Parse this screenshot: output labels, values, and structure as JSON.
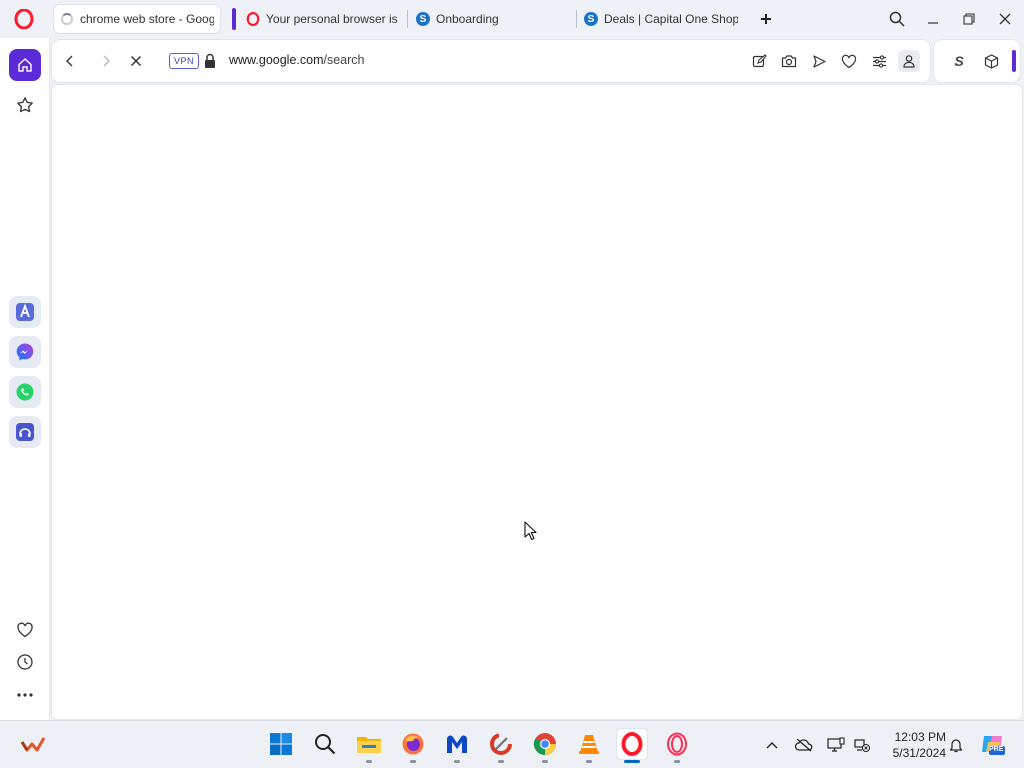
{
  "browser": {
    "tabs": [
      {
        "title": "chrome web store - Google Search",
        "icon": "loading-spinner",
        "active": true
      },
      {
        "title": "Your personal browser is awesome",
        "icon": "opera-icon",
        "active": false
      },
      {
        "title": "Onboarding",
        "icon": "capital-one-shopping-icon",
        "active": false
      },
      {
        "title": "Deals | Capital One Shopping",
        "icon": "capital-one-shopping-icon",
        "active": false
      }
    ],
    "address_bar": {
      "vpn_label": "VPN",
      "url_host": "www.google.com",
      "url_path": "/search"
    },
    "extensions": {
      "capital_one_letter": "S"
    }
  },
  "colors": {
    "opera_red": "#ff1b2d",
    "accent_purple": "#5b2bd8",
    "capital_one_blue": "#1a73c9"
  },
  "taskbar": {
    "clock": {
      "time": "12:03 PM",
      "date": "5/31/2024"
    },
    "copilot_badge": "PRE"
  }
}
